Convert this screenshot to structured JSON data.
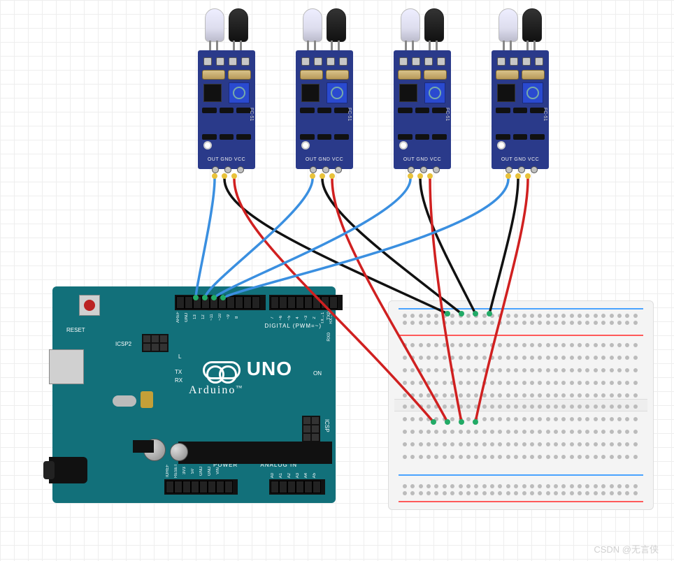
{
  "sensors": [
    {
      "id": 1,
      "model": "FC-51",
      "pins": [
        "OUT",
        "GND",
        "VCC"
      ],
      "arduino_pin": "13"
    },
    {
      "id": 2,
      "model": "FC-51",
      "pins": [
        "OUT",
        "GND",
        "VCC"
      ],
      "arduino_pin": "12"
    },
    {
      "id": 3,
      "model": "FC-51",
      "pins": [
        "OUT",
        "GND",
        "VCC"
      ],
      "arduino_pin": "11"
    },
    {
      "id": 4,
      "model": "FC-51",
      "pins": [
        "OUT",
        "GND",
        "VCC"
      ],
      "arduino_pin": "10"
    }
  ],
  "sensor_pin_labels": "OUT GND VCC",
  "sensor_model_label": "FC-51",
  "arduino": {
    "board": "UNO",
    "brand": "Arduino",
    "tm": "™",
    "reset": "RESET",
    "icsp2": "ICSP2",
    "icsp": "ICSP",
    "digital_label": "DIGITAL (PWM=~)",
    "analog_label": "ANALOG IN",
    "power_label": "POWER",
    "on": "ON",
    "L": "L",
    "TX": "TX",
    "RX": "RX",
    "tx0": "TX0",
    "rx0": "RX0",
    "digital_pins": [
      "AREF",
      "GND",
      "13",
      "12",
      "~11",
      "~10",
      "~9",
      "8",
      "7",
      "~6",
      "~5",
      "4",
      "~3",
      "2",
      "TX→1",
      "RX←0"
    ],
    "power_pins": [
      "IOREF",
      "RESET",
      "3V3",
      "5V",
      "GND",
      "GND",
      "VIN"
    ],
    "analog_pins": [
      "A0",
      "A1",
      "A2",
      "A3",
      "A4",
      "A5"
    ]
  },
  "wiring": {
    "out_color": "#3a8fe0",
    "gnd_color": "#111111",
    "vcc_color": "#d02020",
    "gnd_to": "breadboard-top-rail-neg",
    "vcc_to": "breadboard-bottom-rail-pos"
  },
  "watermark": "CSDN @无言侠",
  "colors": {
    "pcb_sensor": "#2a3a8a",
    "pcb_arduino": "#12707a",
    "breadboard": "#f4f4f4"
  }
}
